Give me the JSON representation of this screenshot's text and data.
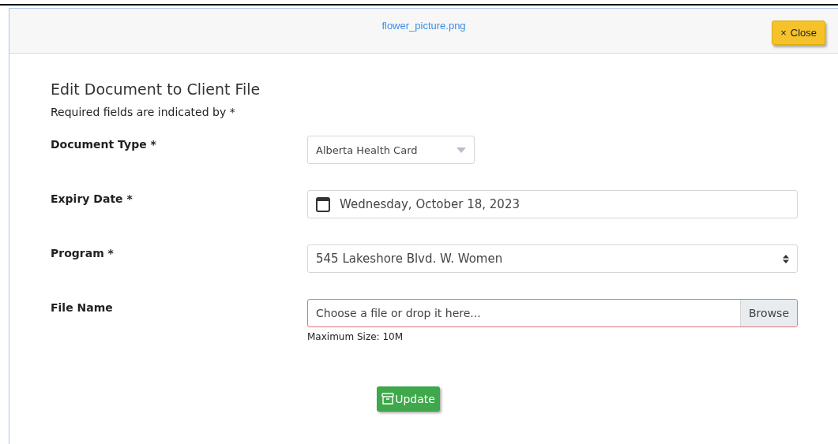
{
  "modal": {
    "title": "flower_picture.png",
    "close_button": {
      "icon": "×",
      "label": "Close"
    }
  },
  "form": {
    "heading": "Edit Document to Client File",
    "note": "Required fields are indicated by *",
    "fields": [
      {
        "kind": "dropdown",
        "label": "Document Type *",
        "value": "Alberta Health Card"
      },
      {
        "kind": "date",
        "label": "Expiry Date *",
        "value": "Wednesday, October 18, 2023"
      },
      {
        "kind": "select",
        "label": "Program *",
        "value": "545 Lakeshore Blvd. W. Women"
      },
      {
        "kind": "file",
        "label": "File Name",
        "placeholder": "Choose a file or drop it here...",
        "button": "Browse",
        "hint": "Maximum Size: 10M",
        "invalid": true
      }
    ],
    "submit": "Update"
  }
}
